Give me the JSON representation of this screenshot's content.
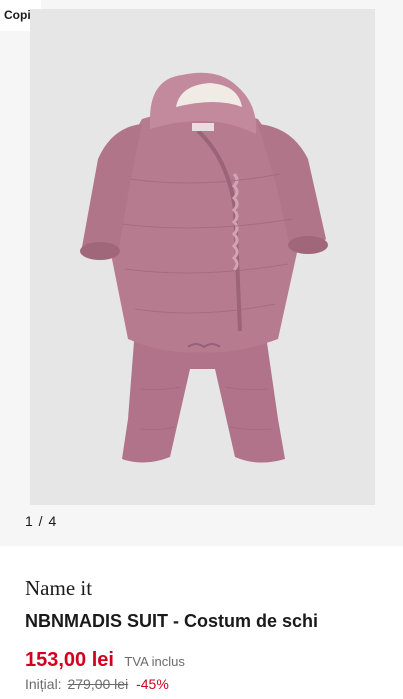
{
  "gallery": {
    "category_tag": "Copii",
    "counter": "1 / 4",
    "image": "pink-quilted-hooded-baby-snowsuit"
  },
  "product": {
    "brand": "Name it",
    "name": "NBNMADIS SUIT - Costum de schi",
    "price": "153,00 lei",
    "vat_label": "TVA inclus",
    "original_label": "Inițial:",
    "original_price": "279,00 lei",
    "discount": "-45%"
  },
  "colors": {
    "accent_red": "#d1001f",
    "garment_pink": "#b57a8e",
    "background": "#f6f6f6"
  }
}
